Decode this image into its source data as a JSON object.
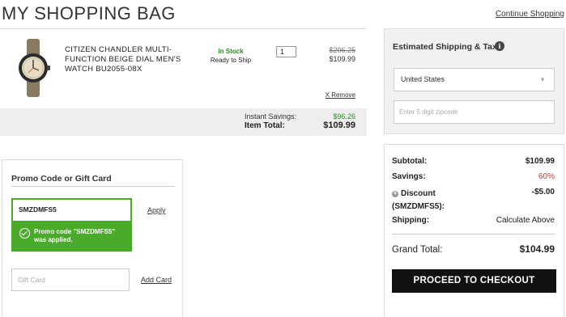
{
  "header": {
    "title": "MY SHOPPING BAG",
    "continue_link": "Continue Shopping"
  },
  "cart": {
    "items": [
      {
        "image_icon": "watch-product-image",
        "name": "CITIZEN CHANDLER MULTI-FUNCTION BEIGE DIAL MEN'S WATCH BU2055-08X",
        "stock_status": "In Stock",
        "stock_note": "Ready to Ship",
        "quantity": "1",
        "original_price": "$206.25",
        "sale_price": "$109.99",
        "remove_label": "X Remove"
      }
    ],
    "instant_savings_label": "Instant Savings:",
    "instant_savings_value": "$96.26",
    "item_total_label": "Item Total:",
    "item_total_value": "$109.99"
  },
  "shipping": {
    "title": "Estimated Shipping & Tax",
    "info_icon": "info-icon",
    "country_selected": "United States",
    "zip_placeholder": "Enter 5 digit zipcode"
  },
  "promo": {
    "title": "Promo Code or Gift Card",
    "code_value": "SMZDMFS5",
    "apply_label": "Apply",
    "success_message": "Promo code \"SMZDMFS5\" was applied.",
    "gift_card_placeholder": "Gift Card",
    "add_card_label": "Add Card"
  },
  "summary": {
    "subtotal_label": "Subtotal:",
    "subtotal_value": "$109.99",
    "savings_label": "Savings:",
    "savings_value": "60%",
    "discount_label": "Discount (SMZDMFS5):",
    "discount_value": "-$5.00",
    "shipping_label": "Shipping:",
    "shipping_value": "Calculate Above",
    "grand_total_label": "Grand Total:",
    "grand_total_value": "$104.99",
    "checkout_label": "PROCEED TO CHECKOUT"
  },
  "colors": {
    "in_stock": "#2a8a1f",
    "savings_green": "#2a8a1f",
    "promo_success_bg": "#4aab2b",
    "savings_percent_red": "#c0392b",
    "checkout_button": "#111111"
  }
}
